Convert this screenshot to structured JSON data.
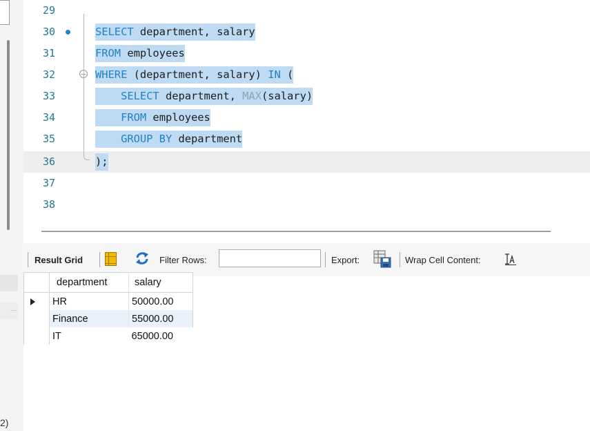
{
  "left_pane": {
    "bottom_text": "2)"
  },
  "editor": {
    "lines": [
      {
        "num": "29"
      },
      {
        "num": "30"
      },
      {
        "num": "31"
      },
      {
        "num": "32"
      },
      {
        "num": "33"
      },
      {
        "num": "34"
      },
      {
        "num": "35"
      },
      {
        "num": "36"
      },
      {
        "num": "37"
      },
      {
        "num": "38"
      }
    ],
    "code": {
      "l30": {
        "kw1": "SELECT",
        "rest": " department, salary"
      },
      "l31": {
        "kw1": "FROM",
        "rest": " employees"
      },
      "l32": {
        "kw1": "WHERE",
        "mid": " (department, salary) ",
        "kw2": "IN",
        "rest": " ("
      },
      "l33": {
        "kw1": "SELECT",
        "mid": " department, ",
        "fn": "MAX",
        "rest": "(salary)"
      },
      "l34": {
        "kw1": "FROM",
        "rest": " employees"
      },
      "l35": {
        "kw1": "GROUP BY",
        "rest": " department"
      },
      "l36": {
        "rest": ");"
      }
    }
  },
  "toolbar": {
    "result_grid": "Result Grid",
    "filter_rows": "Filter Rows:",
    "filter_value": "",
    "export": "Export:",
    "wrap_cell": "Wrap Cell Content:"
  },
  "result": {
    "columns": [
      "department",
      "salary"
    ],
    "rows": [
      [
        "HR",
        "50000.00"
      ],
      [
        "Finance",
        "55000.00"
      ],
      [
        "IT",
        "65000.00"
      ]
    ]
  },
  "colors": {
    "selection": "#bedbf3",
    "keyword": "#1d82c4",
    "line_number": "#237893",
    "breakpoint_dot": "#1a86d6"
  },
  "icons": [
    "grid-layout-icon",
    "refresh-icon",
    "export-icon",
    "wrap-text-icon",
    "fold-toggle-icon",
    "statement-marker-icon",
    "row-pointer-icon"
  ]
}
